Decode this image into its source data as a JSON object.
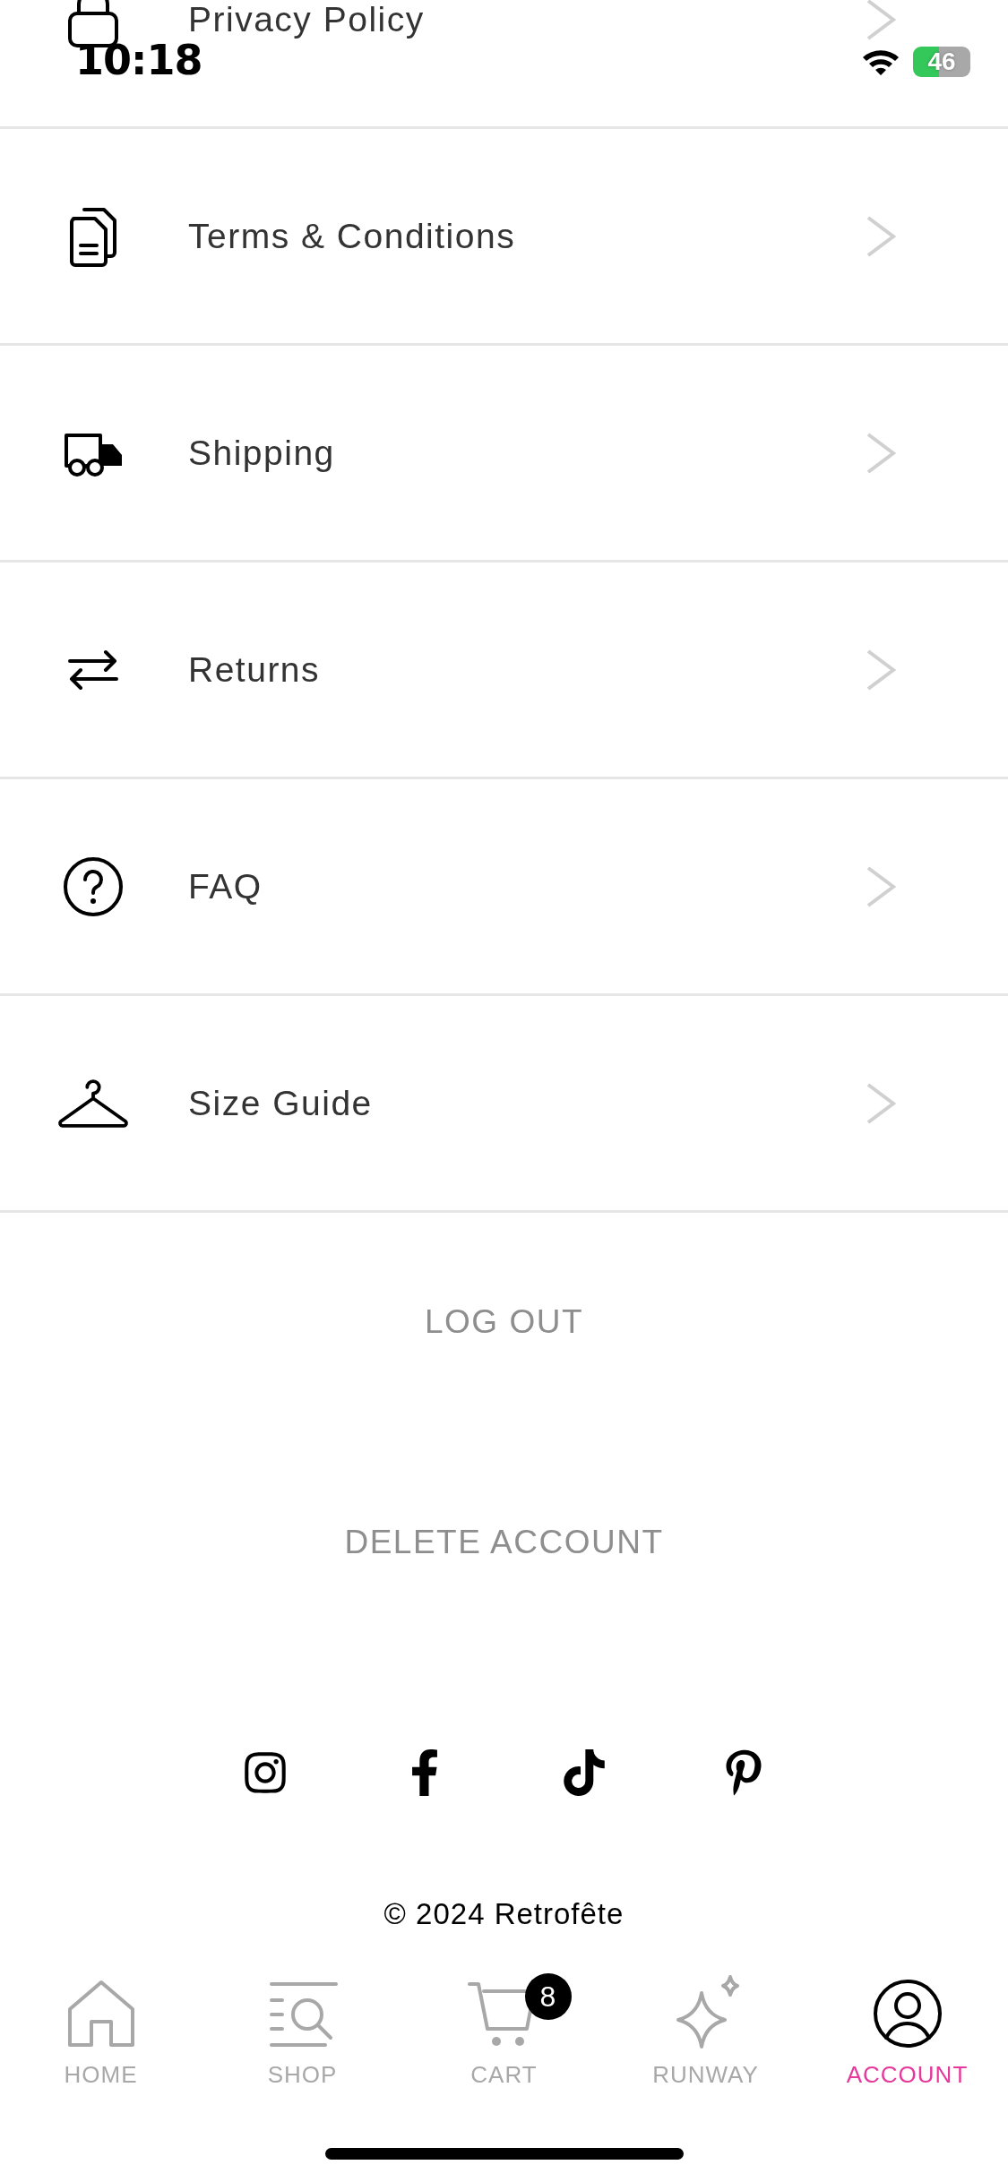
{
  "status_bar": {
    "time": "10:18",
    "battery": "46"
  },
  "menu": [
    {
      "kind": "lock",
      "label": "Privacy Policy"
    },
    {
      "kind": "document",
      "label": "Terms & Conditions"
    },
    {
      "kind": "truck",
      "label": "Shipping"
    },
    {
      "kind": "arrows",
      "label": "Returns"
    },
    {
      "kind": "question",
      "label": "FAQ"
    },
    {
      "kind": "hanger",
      "label": "Size Guide"
    }
  ],
  "actions": [
    "LOG OUT",
    "DELETE ACCOUNT"
  ],
  "copyright": "© 2024 Retrofête",
  "tabs": [
    {
      "label": "HOME",
      "selected": false
    },
    {
      "label": "SHOP",
      "selected": false
    },
    {
      "label": "CART",
      "selected": false,
      "badge": "8"
    },
    {
      "label": "RUNWAY",
      "selected": false
    },
    {
      "label": "ACCOUNT",
      "selected": true
    }
  ]
}
